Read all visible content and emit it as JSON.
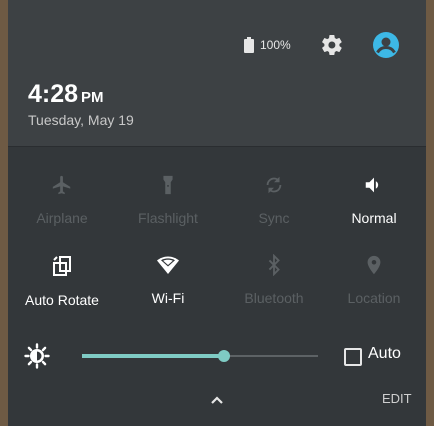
{
  "status": {
    "battery_text": "100%",
    "time": "4:28",
    "ampm": "PM",
    "date": "Tuesday, May 19"
  },
  "tiles": [
    {
      "label": "Airplane",
      "icon": "airplane-icon",
      "state": "off"
    },
    {
      "label": "Flashlight",
      "icon": "flashlight-icon",
      "state": "off"
    },
    {
      "label": "Sync",
      "icon": "sync-icon",
      "state": "off"
    },
    {
      "label": "Normal",
      "icon": "volume-icon",
      "state": "on"
    },
    {
      "label": "Auto Rotate",
      "icon": "auto-rotate-icon",
      "state": "on"
    },
    {
      "label": "Wi-Fi",
      "icon": "wifi-icon",
      "state": "on"
    },
    {
      "label": "Bluetooth",
      "icon": "bluetooth-icon",
      "state": "off"
    },
    {
      "label": "Location",
      "icon": "location-icon",
      "state": "off"
    }
  ],
  "brightness": {
    "level": 0.6,
    "auto_label": "Auto",
    "auto_checked": false
  },
  "footer": {
    "edit_label": "EDIT"
  },
  "colors": {
    "accent": "#7fcbc4",
    "account": "#3db8e6",
    "active_text": "#ffffff",
    "inactive": "#5b6063"
  }
}
